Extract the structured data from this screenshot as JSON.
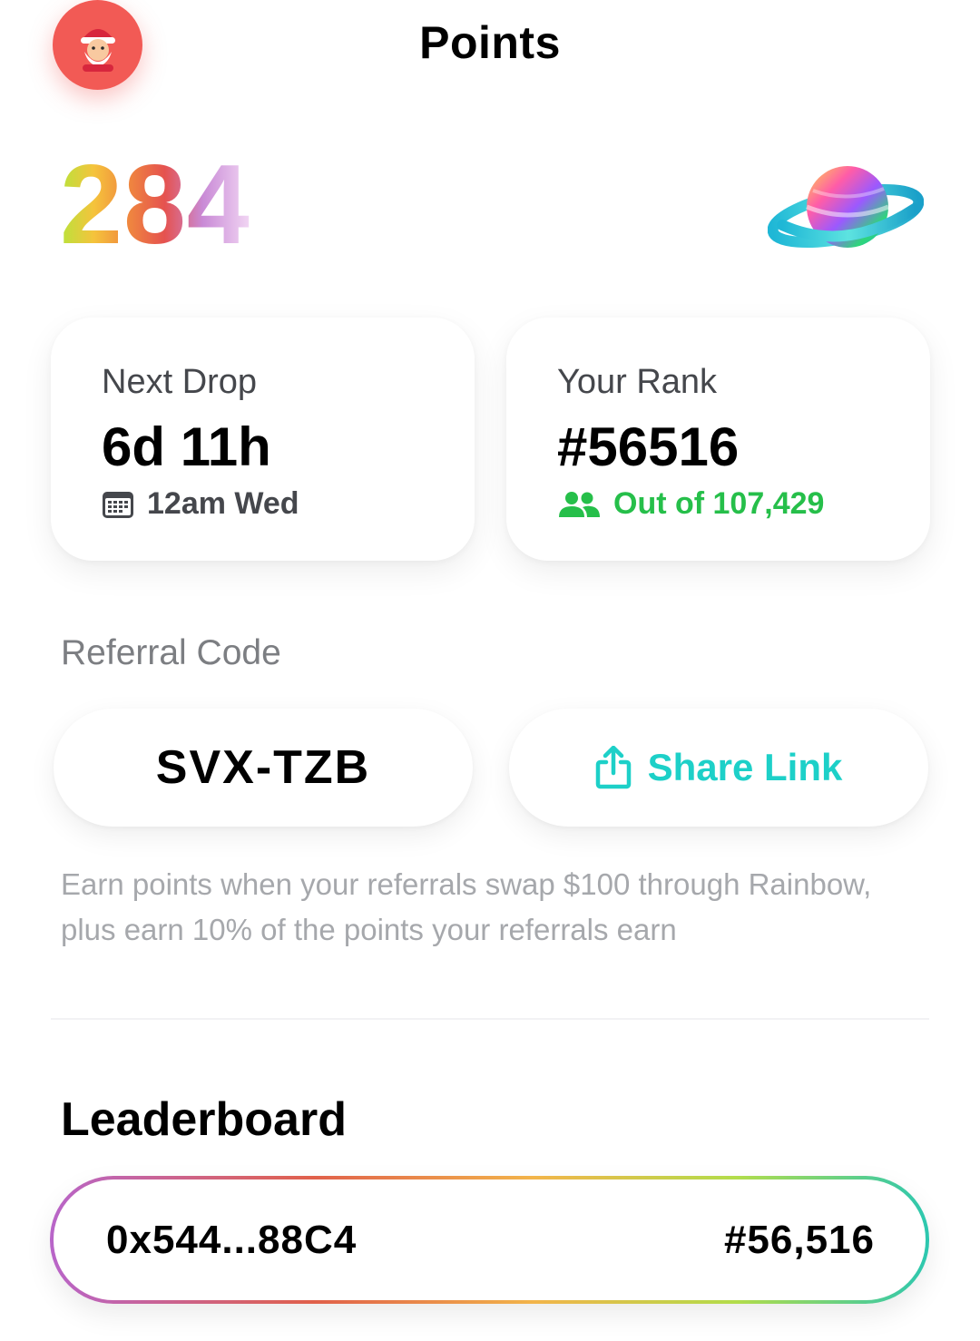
{
  "header": {
    "title": "Points",
    "avatar_icon": "santa-avatar-icon"
  },
  "points": {
    "value": "284",
    "planet_icon": "planet-icon"
  },
  "next_drop": {
    "label": "Next Drop",
    "value": "6d 11h",
    "sub": "12am Wed",
    "sub_icon": "calendar-icon"
  },
  "rank": {
    "label": "Your Rank",
    "value": "#56516",
    "sub": "Out of 107,429",
    "sub_icon": "users-icon"
  },
  "referral": {
    "label": "Referral Code",
    "code": "SVX-TZB",
    "share_label": "Share Link",
    "share_icon": "share-icon",
    "info": "Earn points when your referrals swap $100 through Rainbow, plus earn 10% of the points your referrals earn"
  },
  "leaderboard": {
    "title": "Leaderboard",
    "entry": {
      "address": "0x544...88C4",
      "rank": "#56,516"
    }
  },
  "colors": {
    "avatar_bg": "#f25a55",
    "accent_green": "#26bf4a",
    "accent_teal": "#1dd0c8"
  }
}
